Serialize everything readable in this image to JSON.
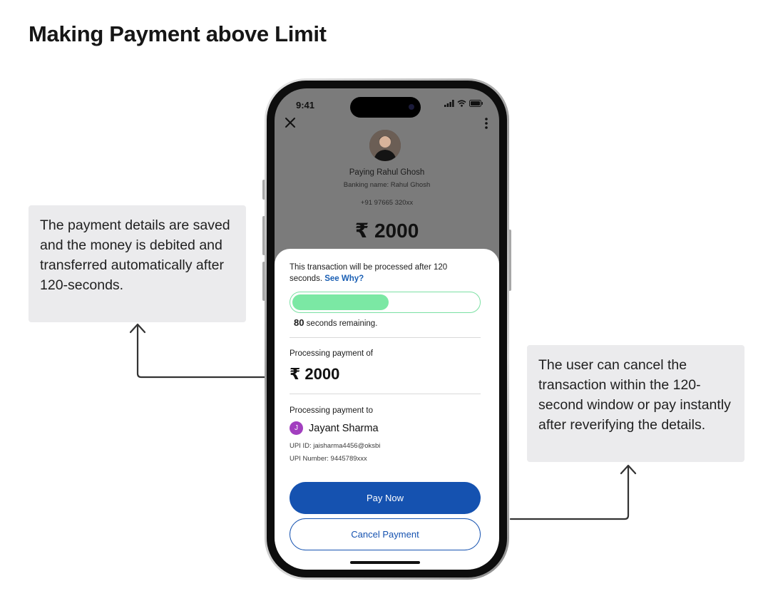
{
  "page": {
    "title": "Making Payment above Limit"
  },
  "notes": {
    "left": "The payment details are saved and the money is debited and transferred automatically after 120-seconds.",
    "right": "The user can cancel the transaction within the 120-second window or pay instantly after reverifying the details."
  },
  "phone": {
    "status_time": "9:41",
    "payee": {
      "title": "Paying Rahul Ghosh",
      "banking_name": "Banking name: Rahul Ghosh",
      "phone": "+91 97665 320xx",
      "amount": "₹ 2000"
    },
    "sheet": {
      "notice": "This transaction will be processed after 120 seconds.",
      "see_why": "See Why?",
      "progress_fraction": 0.52,
      "seconds_remaining": "80",
      "remaining_suffix": "seconds remaining.",
      "processing_of_label": "Processing payment of",
      "amount": "₹ 2000",
      "processing_to_label": "Processing payment to",
      "recipient_initial": "J",
      "recipient_name": "Jayant Sharma",
      "upi_id": "UPI ID: jaisharma4456@oksbi",
      "upi_number": "UPI Number: 9445789xxx",
      "pay_now": "Pay Now",
      "cancel": "Cancel Payment"
    }
  },
  "icons": [
    "close-icon",
    "more-vertical-icon",
    "signal-icon",
    "wifi-icon",
    "battery-icon",
    "arrow-up-icon"
  ],
  "colors": {
    "primary": "#1552b0",
    "progress": "#7be8a4",
    "recipient_badge": "#a23fbf",
    "note_bg": "#ebebed"
  }
}
